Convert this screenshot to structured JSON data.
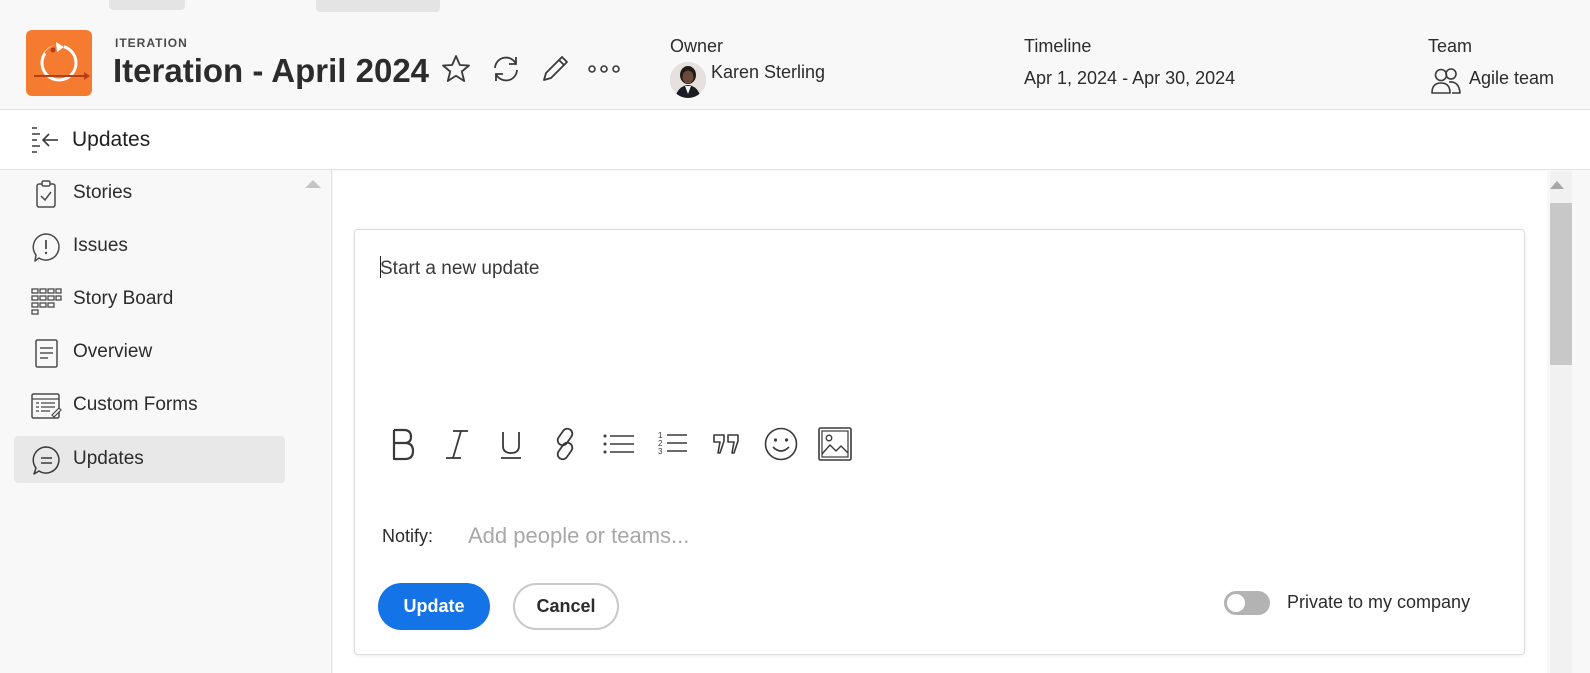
{
  "header": {
    "object_type": "ITERATION",
    "title": "Iteration - April 2024",
    "owner_label": "Owner",
    "owner_name": "Karen Sterling",
    "timeline_label": "Timeline",
    "timeline_value": "Apr 1, 2024 - Apr 30, 2024",
    "team_label": "Team",
    "team_name": "Agile team",
    "accent_color": "#f47b2f",
    "actions": [
      "star-icon",
      "refresh-icon",
      "edit-pencil-icon",
      "more-icon"
    ]
  },
  "subbar": {
    "title": "Updates"
  },
  "sidebar": {
    "items": [
      {
        "label": "Stories",
        "icon": "clipboard-check-icon"
      },
      {
        "label": "Issues",
        "icon": "issue-bubble-icon"
      },
      {
        "label": "Story Board",
        "icon": "board-grid-icon"
      },
      {
        "label": "Overview",
        "icon": "document-icon"
      },
      {
        "label": "Custom Forms",
        "icon": "forms-icon"
      },
      {
        "label": "Updates",
        "icon": "chat-bubble-icon",
        "active": true
      }
    ]
  },
  "editor": {
    "placeholder": "Start a new update",
    "toolbar": [
      "bold-icon",
      "italic-icon",
      "underline-icon",
      "link-icon",
      "bulleted-list-icon",
      "numbered-list-icon",
      "quote-icon",
      "emoji-icon",
      "image-icon"
    ],
    "notify_label": "Notify:",
    "notify_placeholder": "Add people or teams...",
    "update_button": "Update",
    "cancel_button": "Cancel",
    "private_label": "Private to my company",
    "private_enabled": false,
    "primary_color": "#1473e6"
  }
}
